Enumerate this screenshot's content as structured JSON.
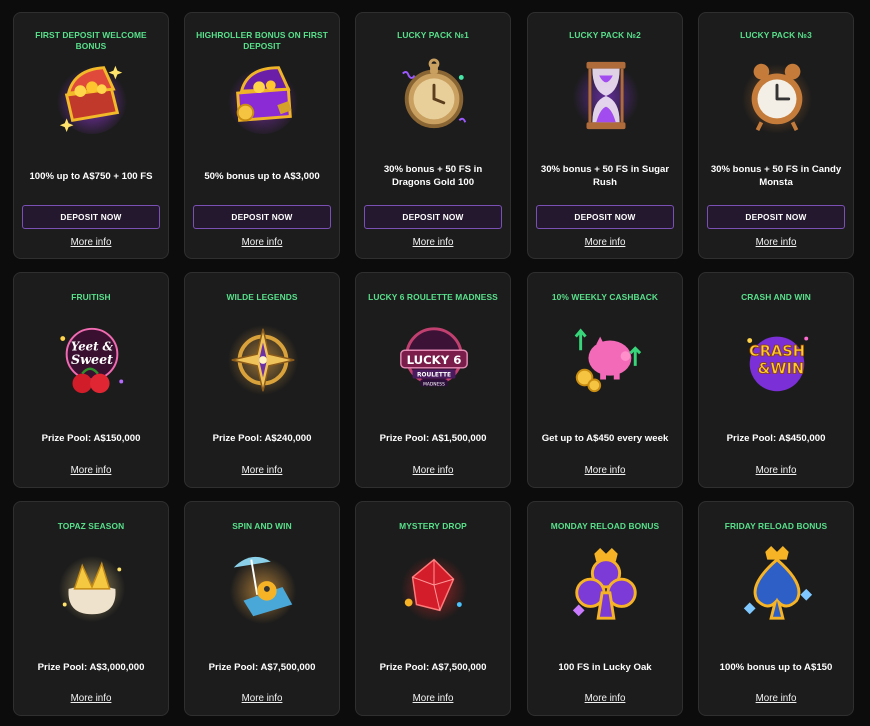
{
  "cards": [
    {
      "title": "FIRST DEPOSIT WELCOME BONUS",
      "offer": "100% up to A$750 + 100 FS",
      "button": "DEPOSIT NOW",
      "more": "More info",
      "icon": "treasure-chest-icon"
    },
    {
      "title": "HIGHROLLER BONUS ON FIRST DEPOSIT",
      "offer": "50% bonus up to A$3,000",
      "button": "DEPOSIT NOW",
      "more": "More info",
      "icon": "treasure-chest-coins-icon"
    },
    {
      "title": "LUCKY PACK №1",
      "offer": "30% bonus + 50 FS in Dragons Gold 100",
      "button": "DEPOSIT NOW",
      "more": "More info",
      "icon": "pocket-watch-icon"
    },
    {
      "title": "LUCKY PACK №2",
      "offer": "30% bonus + 50 FS in Sugar Rush",
      "button": "DEPOSIT NOW",
      "more": "More info",
      "icon": "hourglass-icon"
    },
    {
      "title": "LUCKY PACK №3",
      "offer": "30% bonus + 50 FS in Candy Monsta",
      "button": "DEPOSIT NOW",
      "more": "More info",
      "icon": "alarm-clock-icon"
    },
    {
      "title": "FRUITISH",
      "offer": "Prize Pool: A$150,000",
      "more": "More info",
      "icon": "sweet-cherries-icon",
      "logo": [
        "Yeet &",
        "Sweet"
      ]
    },
    {
      "title": "WILDE LEGENDS",
      "offer": "Prize Pool: A$240,000",
      "more": "More info",
      "icon": "compass-star-icon"
    },
    {
      "title": "LUCKY 6 ROULETTE MADNESS",
      "offer": "Prize Pool: A$1,500,000",
      "more": "More info",
      "icon": "roulette-badge-icon",
      "logo": [
        "LUCKY 6",
        "ROULETTE",
        "MADNESS"
      ]
    },
    {
      "title": "10% WEEKLY CASHBACK",
      "offer": "Get up to A$450 every week",
      "more": "More info",
      "icon": "piggy-bank-icon"
    },
    {
      "title": "CRASH AND WIN",
      "offer": "Prize Pool: A$450,000",
      "more": "More info",
      "icon": "crash-win-logo-icon",
      "logo": [
        "CRASH",
        "&WIN"
      ]
    },
    {
      "title": "TOPAZ SEASON",
      "offer": "Prize Pool: A$3,000,000",
      "more": "More info",
      "icon": "gem-sack-icon"
    },
    {
      "title": "SPIN AND WIN",
      "offer": "Prize Pool: A$7,500,000",
      "more": "More info",
      "icon": "beach-chair-icon"
    },
    {
      "title": "MYSTERY DROP",
      "offer": "Prize Pool: A$7,500,000",
      "more": "More info",
      "icon": "red-gem-icon"
    },
    {
      "title": "MONDAY RELOAD BONUS",
      "offer": "100 FS in Lucky Oak",
      "more": "More info",
      "icon": "club-crown-icon"
    },
    {
      "title": "FRIDAY RELOAD BONUS",
      "offer": "100% bonus up to A$150",
      "more": "More info",
      "icon": "spade-crown-icon"
    }
  ]
}
